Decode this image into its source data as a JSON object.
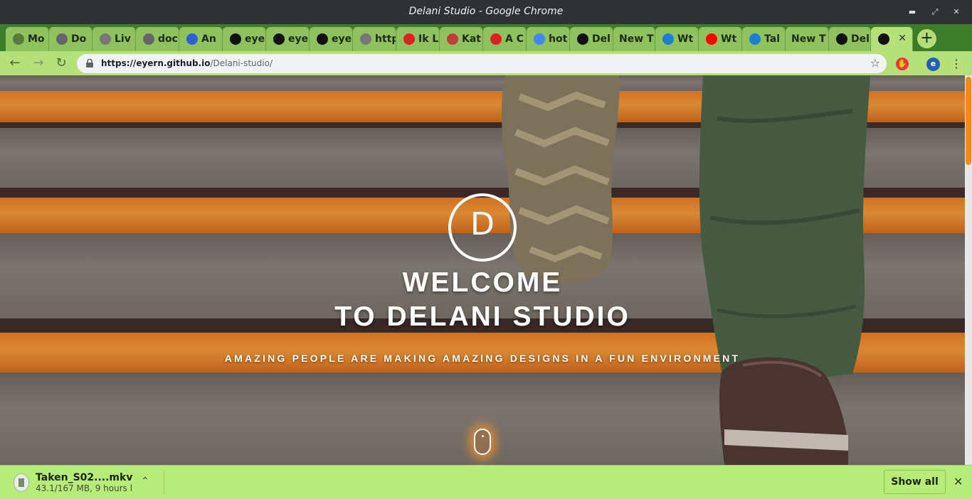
{
  "window": {
    "title": "Delani Studio - Google Chrome",
    "controls": [
      "minimize-icon",
      "maximize-icon",
      "close-icon"
    ]
  },
  "tabs": [
    {
      "label": "Mo",
      "icon": "tree-icon",
      "color": "#5a7a3a"
    },
    {
      "label": "Do",
      "icon": "download-icon",
      "color": "#666666"
    },
    {
      "label": "Liv",
      "icon": "globe-icon",
      "color": "#777777"
    },
    {
      "label": "doc",
      "icon": "list-icon",
      "color": "#666666"
    },
    {
      "label": "An",
      "icon": "dotted-ring-icon",
      "color": "#2e5fd6"
    },
    {
      "label": "eye",
      "icon": "e-letter-icon",
      "color": "#111111"
    },
    {
      "label": "eye",
      "icon": "github-icon",
      "color": "#111111"
    },
    {
      "label": "eye",
      "icon": "github-icon",
      "color": "#111111"
    },
    {
      "label": "http",
      "icon": "globe-icon",
      "color": "#777777"
    },
    {
      "label": "Ik L",
      "icon": "red-square-icon",
      "color": "#e02020"
    },
    {
      "label": "Kat",
      "icon": "knot-icon",
      "color": "#c23a3a"
    },
    {
      "label": "A C",
      "icon": "red-bars-icon",
      "color": "#e02020"
    },
    {
      "label": "hot",
      "icon": "google-icon",
      "color": "#4285f4"
    },
    {
      "label": "Del",
      "icon": "d-logo-icon",
      "color": "#111111"
    },
    {
      "label": "New T",
      "icon": "",
      "color": ""
    },
    {
      "label": "Wt",
      "icon": "mw-icon",
      "color": "#1a7fd0"
    },
    {
      "label": "Wt",
      "icon": "youtube-icon",
      "color": "#ff0000"
    },
    {
      "label": "Tal",
      "icon": "mw-icon",
      "color": "#1a7fd0"
    },
    {
      "label": "New T",
      "icon": "",
      "color": ""
    },
    {
      "label": "Del",
      "icon": "d-logo-icon",
      "color": "#111111"
    },
    {
      "label": "",
      "icon": "d-logo-icon",
      "color": "#111111",
      "active": true
    }
  ],
  "toolbar": {
    "url_host": "https://eyern.github.io",
    "url_path": "/Delani-studio/",
    "profile_letter": "e"
  },
  "page": {
    "logo_letter": "D",
    "heading_line1": "WELCOME",
    "heading_line2": "TO DELANI STUDIO",
    "tagline": "AMAZING PEOPLE ARE MAKING AMAZING DESIGNS IN A FUN ENVIRONMENT"
  },
  "download": {
    "filename": "Taken_S02....mkv",
    "status": "43.1/167 MB, 9 hours l",
    "show_all": "Show all"
  },
  "colors": {
    "tab_strip": "#3d7d2a",
    "toolbar": "#b6e07a",
    "download_bar": "#b8ec7a",
    "accent_orange": "#f28a1e"
  }
}
